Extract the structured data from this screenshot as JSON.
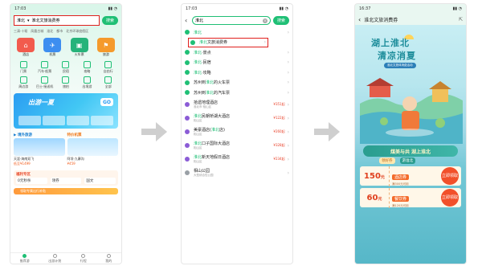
{
  "phone1": {
    "status_time": "17:03",
    "search": {
      "city": "淮北",
      "query": "淮北文旅消费券",
      "button": "搜索"
    },
    "tags": [
      "三清·十堰",
      "凤凰古城",
      "淮北",
      "都市",
      "北京环球度假区"
    ],
    "big_icons": [
      {
        "label": "酒店",
        "color": "#f25b4d"
      },
      {
        "label": "机票",
        "color": "#3d8ef0"
      },
      {
        "label": "火车票",
        "color": "#26b37a"
      },
      {
        "label": "旅游",
        "color": "#f59a2c"
      }
    ],
    "small_icons": [
      "门票",
      "汽车·船票",
      "民宿",
      "攻略",
      "自由行",
      "周边游",
      "巴士·接送机",
      "旅拍",
      "出境游",
      "全部"
    ],
    "banner": {
      "title": "出游一夏",
      "go": "GO"
    },
    "deals": [
      {
        "header": "▶ 境外旅游",
        "caption": "天涯·海南双飞",
        "price": "低至¥1499"
      },
      {
        "header": "特价机票",
        "caption": "阿坝·九寨沟",
        "price": "¥459"
      }
    ],
    "fuli": {
      "header": "福利专区",
      "items": [
        "0元秒杀",
        "领券",
        "国文"
      ]
    },
    "orange_bar": "领取专属出行补贴",
    "tabs": [
      "推荐游",
      "出游计划",
      "行程",
      "我的"
    ]
  },
  "phone2": {
    "status_time": "17:03",
    "search": {
      "query": "淮北",
      "button": "搜索"
    },
    "suggestions": [
      {
        "icon": "g",
        "prefix": "",
        "hl": "淮北",
        "suffix": "",
        "sub": "",
        "price": ""
      },
      {
        "icon": "g",
        "prefix": "",
        "hl": "淮北",
        "suffix": "文旅消费券",
        "sub": "",
        "price": "",
        "selected": true
      },
      {
        "icon": "g",
        "prefix": "",
        "hl": "淮北",
        "suffix": "·景点",
        "sub": "",
        "price": ""
      },
      {
        "icon": "g",
        "prefix": "",
        "hl": "淮北",
        "suffix": "·民宿",
        "sub": "",
        "price": ""
      },
      {
        "icon": "g",
        "prefix": "",
        "hl": "淮北",
        "suffix": "·攻略",
        "sub": "",
        "price": ""
      },
      {
        "icon": "g",
        "prefix": "苏州到",
        "hl": "淮北",
        "suffix": "的火车票",
        "sub": "",
        "price": ""
      },
      {
        "icon": "g",
        "prefix": "苏州到",
        "hl": "淮北",
        "suffix": "的汽车票",
        "sub": "",
        "price": ""
      },
      {
        "icon": "p",
        "prefix": "",
        "hl": "",
        "suffix": "拾遗地理酒店",
        "sub": "淮北市·相山区",
        "price": "¥351起"
      },
      {
        "icon": "p",
        "prefix": "",
        "hl": "淮北",
        "suffix": "民朝桥湖大酒店",
        "sub": "相山区",
        "price": "¥122起"
      },
      {
        "icon": "p",
        "prefix": "美豪酒店(",
        "hl": "淮北",
        "suffix": "店)",
        "sub": "相山区",
        "price": "¥260起"
      },
      {
        "icon": "p",
        "prefix": "",
        "hl": "淮北",
        "suffix": "口子国际大酒店",
        "sub": "相山区",
        "price": "¥328起"
      },
      {
        "icon": "p",
        "prefix": "",
        "hl": "淮北",
        "suffix": "新天地假日酒店",
        "sub": "相山区",
        "price": "¥234起"
      },
      {
        "icon": "gr",
        "prefix": "",
        "hl": "",
        "suffix": "相山公园",
        "sub": "大型综合性公园",
        "price": ""
      }
    ]
  },
  "phone3": {
    "status_time": "16:37",
    "title": "淮北文旅消费券",
    "poster": {
      "line1": "湖上淮北",
      "line2": "清凉消夏",
      "pill": "淮北文旅体消费活动",
      "slogan": "煤美与共 湖上淮北",
      "tab1": "领好券",
      "tab2": "游淮北"
    },
    "coupons": [
      {
        "amount": "150",
        "unit": "元",
        "name": "酒店券",
        "desc": "满300元可用",
        "button": "立即领取"
      },
      {
        "amount": "60",
        "unit": "元",
        "name": "餐饮券",
        "desc": "满120元可用",
        "button": "立即领取"
      }
    ]
  }
}
